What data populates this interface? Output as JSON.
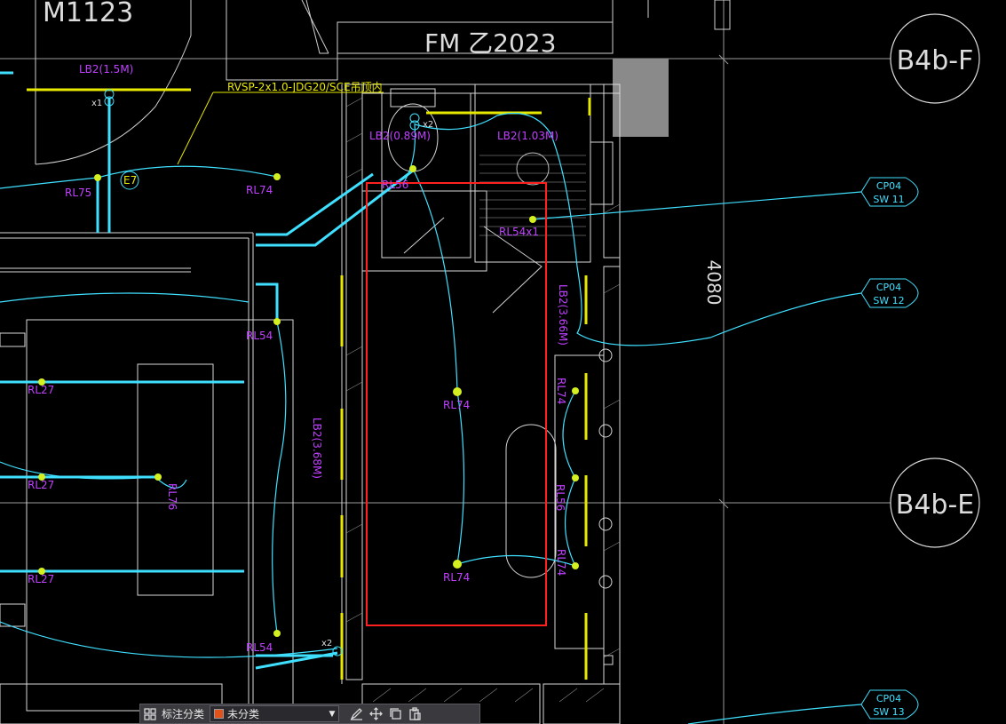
{
  "drawing": {
    "top_labels": {
      "door_tag_left": "M1123",
      "door_tag_center": "FM 乙2023"
    },
    "grid_bubbles": [
      {
        "label": "B4b-F"
      },
      {
        "label": "B4b-E"
      }
    ],
    "dimension": "4080",
    "circuit_tags": [
      {
        "line1": "CP04",
        "line2": "SW 11"
      },
      {
        "line1": "CP04",
        "line2": "SW 12"
      },
      {
        "line1": "CP04",
        "line2": "SW 13"
      }
    ],
    "cable_note": "RVSP-2x1.0-JDG20/SCE吊顶内",
    "fixture_labels": {
      "lb2_1_5": "LB2(1.5M)",
      "lb2_0_89": "LB2(0.89M)",
      "lb2_1_03": "LB2(1.03M)",
      "lb2_3_66": "LB2(3.66M)",
      "lb2_3_68": "LB2(3.68M)",
      "rl75": "RL75",
      "rl74_a": "RL74",
      "rl74_center_1": "RL74",
      "rl74_center_2": "RL74",
      "rl74_right_1": "RL74",
      "rl74_right_2": "RL74",
      "rl54_top": "RL54",
      "rl54_bottom": "RL54",
      "rl27_1": "RL27",
      "rl27_2": "RL27",
      "rl27_3": "RL27",
      "rl76": "RL76",
      "rl56": "RL56",
      "rl56_right": "RL56",
      "rl54_x1": "RL54x1",
      "e7": "E7",
      "x1": "x1",
      "x2_top": "x2",
      "x2_bottom": "x2"
    },
    "colors": {
      "background": "#000000",
      "wire_cyan": "#3fe0ff",
      "wall_white": "#d8d8d8",
      "label_magenta": "#c040ff",
      "fixture_yellow": "#e8e800",
      "fixture_dot": "#d4f020",
      "selection_red": "#ff2020",
      "grid_gray": "#9a9a9a"
    }
  },
  "toolbar": {
    "icons": [
      "grid-icon",
      "edit-icon",
      "move-icon",
      "copy-icon",
      "paste-icon"
    ],
    "category_label": "标注分类",
    "category_value": "未分类"
  }
}
